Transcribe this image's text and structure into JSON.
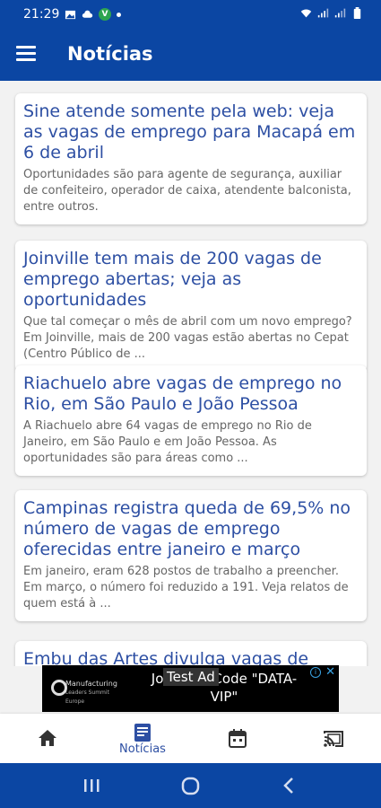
{
  "status_bar": {
    "time": "21:29"
  },
  "app_bar": {
    "title": "Notícias"
  },
  "articles": [
    {
      "title": "Sine atende somente pela web: veja as vagas de emprego para Macapá em 6 de abril",
      "summary": "Oportunidades são para agente de segurança, auxiliar de confeiteiro, operador de caixa, atendente balconista, entre outros."
    },
    {
      "title": "Joinville tem mais de 200 vagas de emprego abertas; veja as oportunidades",
      "summary": "Que tal começar o mês de abril com um novo emprego? Em Joinville, mais de 200 vagas estão abertas no Cepat (Centro Público de ..."
    },
    {
      "title": "Riachuelo abre vagas de emprego no Rio, em São Paulo e João Pessoa",
      "summary": "A Riachuelo abre 64 vagas de emprego no Rio de Janeiro, em São Paulo e em João Pessoa. As oportunidades são para áreas como ..."
    },
    {
      "title": "Campinas registra queda de 69,5% no número de vagas de emprego oferecidas entre janeiro e março",
      "summary": "Em janeiro, eram 628 postos de trabalho a preencher. Em março, o número foi reduzido a 191. Veja relatos de quem está à ..."
    },
    {
      "title": "Embu das Artes divulga vagas de",
      "summary": ""
    }
  ],
  "ad": {
    "label": "Test Ad",
    "text": "Join with Code \"DATA-VIP\"",
    "logo_text": "Manufacturing",
    "logo_subtext": "Leaders Summit Europe"
  },
  "bottom_nav": {
    "items": [
      {
        "icon": "home-icon",
        "label": ""
      },
      {
        "icon": "news-icon",
        "label": "Notícias"
      },
      {
        "icon": "calendar-icon",
        "label": ""
      },
      {
        "icon": "cast-icon",
        "label": ""
      }
    ],
    "accent": "#2d4fa3"
  },
  "colors": {
    "primary": "#0b46a3",
    "title_text": "#2d4fa3",
    "summary_text": "#666666"
  }
}
